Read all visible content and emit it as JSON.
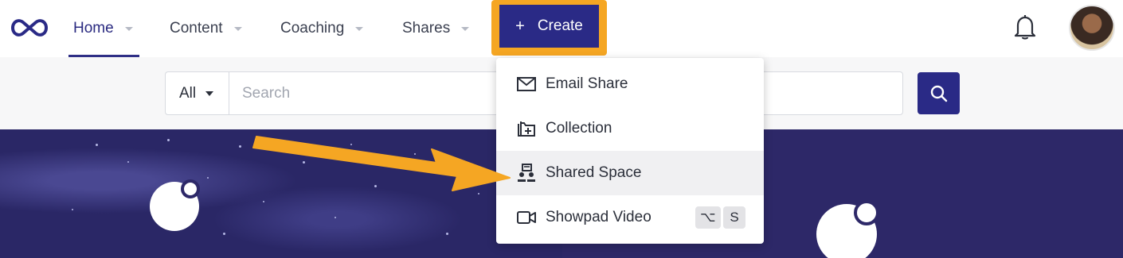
{
  "nav": {
    "items": [
      {
        "label": "Home",
        "active": true
      },
      {
        "label": "Content"
      },
      {
        "label": "Coaching"
      },
      {
        "label": "Shares"
      }
    ],
    "create_label": "Create",
    "create_icon": "plus-icon",
    "bell_icon": "bell-icon",
    "logo_icon": "infinity-logo-icon"
  },
  "search": {
    "scope": "All",
    "placeholder": "Search",
    "button_icon": "search-icon"
  },
  "create_menu": {
    "items": [
      {
        "label": "Email Share",
        "icon": "envelope-icon"
      },
      {
        "label": "Collection",
        "icon": "folder-plus-icon"
      },
      {
        "label": "Shared Space",
        "icon": "shared-space-icon",
        "highlighted": true
      },
      {
        "label": "Showpad Video",
        "icon": "video-camera-icon",
        "shortcut": [
          "⌥",
          "S"
        ]
      }
    ]
  },
  "colors": {
    "brand": "#2a2a86",
    "highlight": "#f5a623",
    "hero": "#2d2868"
  }
}
